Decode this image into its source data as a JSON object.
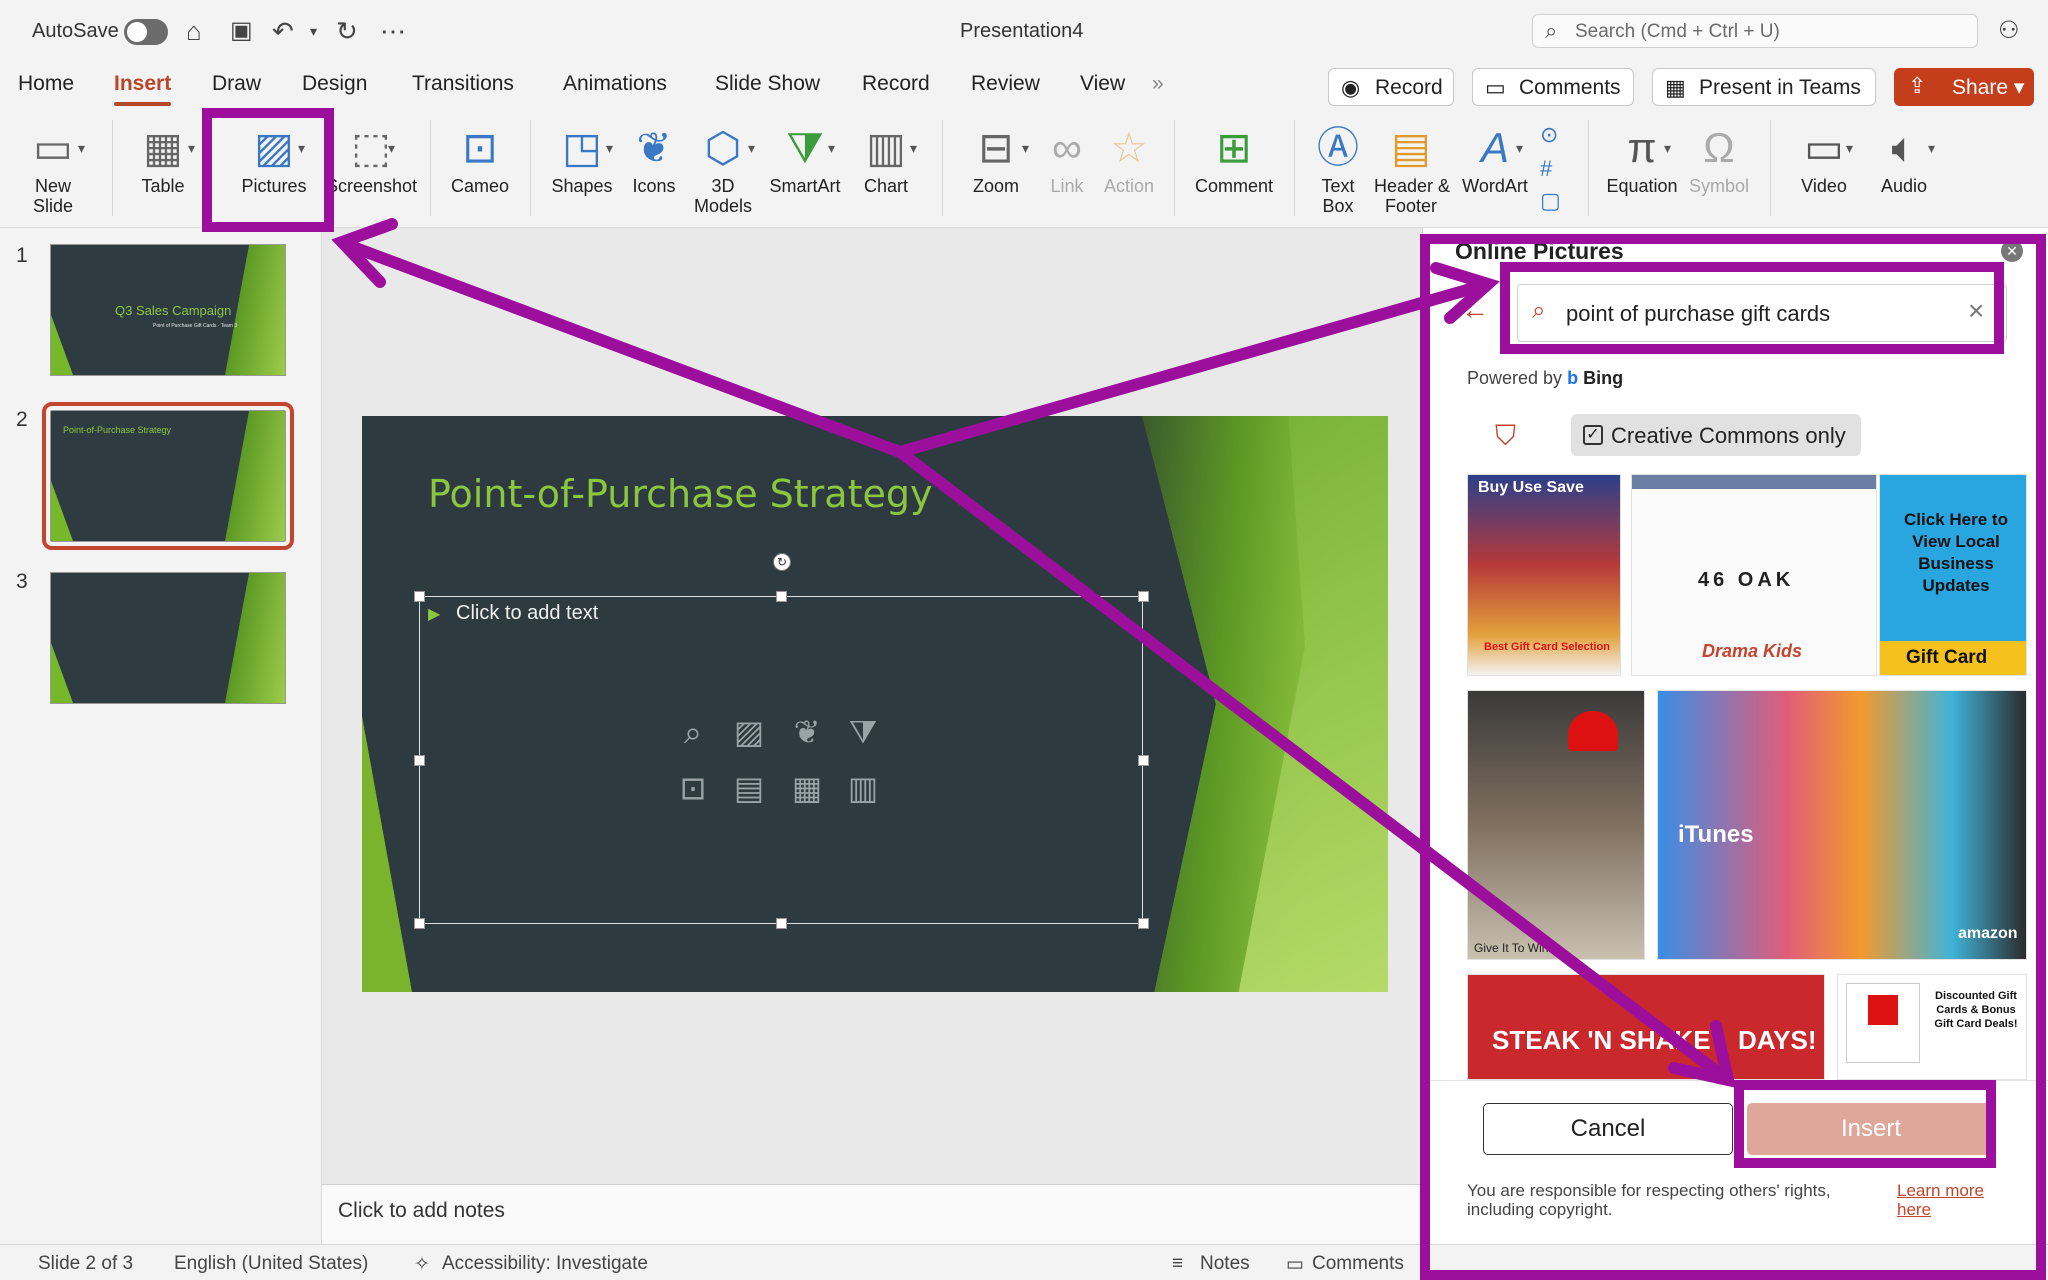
{
  "titlebar": {
    "autosave_label": "AutoSave",
    "doc_title": "Presentation4",
    "search_placeholder": "Search (Cmd + Ctrl + U)"
  },
  "tabs": [
    "Home",
    "Insert",
    "Draw",
    "Design",
    "Transitions",
    "Animations",
    "Slide Show",
    "Record",
    "Review",
    "View"
  ],
  "active_tab": "Insert",
  "header_buttons": {
    "record": "Record",
    "comments": "Comments",
    "present": "Present in Teams",
    "share": "Share"
  },
  "ribbon": {
    "new_slide": "New\nSlide",
    "table": "Table",
    "pictures": "Pictures",
    "screenshot": "Screenshot",
    "cameo": "Cameo",
    "shapes": "Shapes",
    "icons": "Icons",
    "models": "3D\nModels",
    "smartart": "SmartArt",
    "chart": "Chart",
    "zoom": "Zoom",
    "link": "Link",
    "action": "Action",
    "comment": "Comment",
    "textbox": "Text\nBox",
    "header_footer": "Header &\nFooter",
    "wordart": "WordArt",
    "equation": "Equation",
    "symbol": "Symbol",
    "video": "Video",
    "audio": "Audio"
  },
  "thumbnails": [
    {
      "num": "1",
      "title": "Q3 Sales Campaign",
      "subtitle": "Point of Purchase Gift Cards · Team 3"
    },
    {
      "num": "2",
      "title": "Point-of-Purchase Strategy"
    },
    {
      "num": "3",
      "title": ""
    }
  ],
  "slide": {
    "title": "Point-of-Purchase Strategy",
    "body_placeholder": "Click to add text"
  },
  "notes_placeholder": "Click to add notes",
  "pane": {
    "title": "Online Pictures",
    "search_value": "point of purchase gift cards",
    "powered_by": "Powered by",
    "bing": "Bing",
    "filter_label": "Creative Commons only",
    "images": [
      {
        "caption": "Buy Use Save",
        "sub": "Best Gift Card Selection"
      },
      {
        "caption": "46 OAK",
        "sub": "Drama Kids"
      },
      {
        "caption": "Click Here to View Local Business Updates",
        "sub": "Gift Card"
      },
      {
        "caption": "Give It To Win",
        "sub": ""
      },
      {
        "caption": "iTunes",
        "sub": "amazon"
      },
      {
        "caption": "STEAK 'N SHAKE",
        "sub": "DAYS!"
      },
      {
        "caption": "Discounted Gift Cards & Bonus Gift Card Deals!",
        "sub": ""
      }
    ],
    "cancel": "Cancel",
    "insert": "Insert",
    "disclaimer": "You are responsible for respecting others' rights, including copyright.",
    "learn_more": "Learn more here"
  },
  "status": {
    "slide_of": "Slide 2 of 3",
    "language": "English (United States)",
    "accessibility": "Accessibility: Investigate",
    "notes": "Notes",
    "comments": "Comments"
  },
  "colors": {
    "accent": "#b7472a",
    "annotation": "#9c0f9c",
    "slide_bg": "#2d3a40",
    "slide_title": "#8cc63f"
  }
}
